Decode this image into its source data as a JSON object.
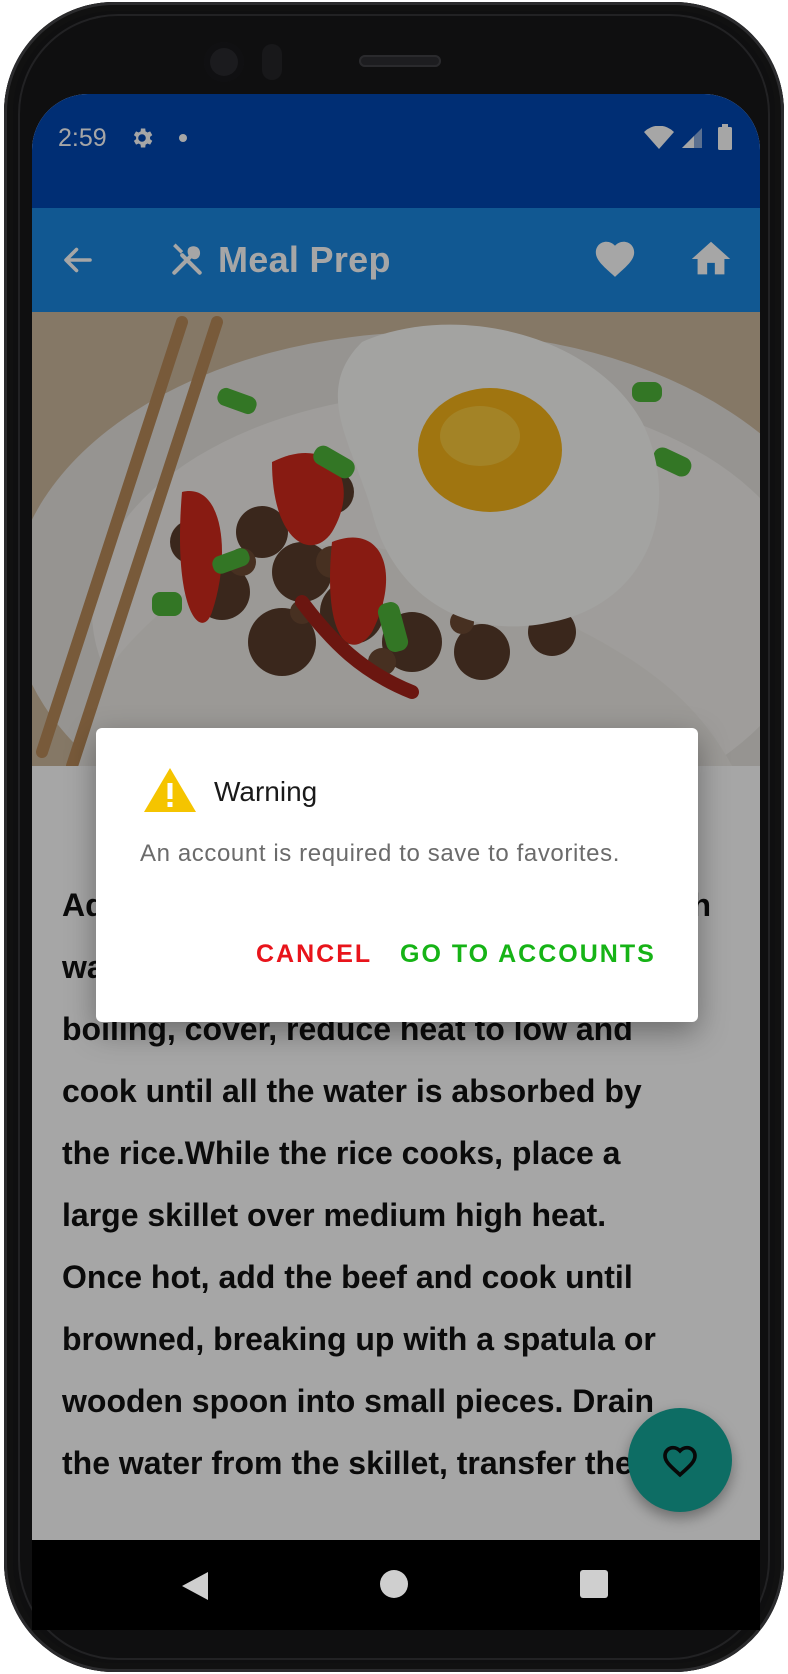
{
  "status_bar": {
    "time": "2:59"
  },
  "app_bar": {
    "title": "Meal Prep"
  },
  "recipe": {
    "instructions": "Add rice to a medium saucepan along with water. Once\nboiling, cover, reduce heat to low and\ncook until all the water is absorbed by\nthe rice.While the rice cooks, place a\nlarge skillet over medium high heat.\nOnce hot, add the beef and cook until\nbrowned, breaking up with a spatula or\nwooden spoon into small pieces. Drain\nthe water from the skillet, transfer the"
  },
  "dialog": {
    "title": "Warning",
    "message": "An account is required to save to favorites.",
    "cancel_label": "CANCEL",
    "confirm_label": "GO TO ACCOUNTS"
  },
  "colors": {
    "status_bar": "#0047b3",
    "app_bar": "#1b88e0",
    "fab": "#14a89a",
    "cancel": "#e8141b",
    "confirm": "#16b316",
    "warning": "#f5c400"
  }
}
